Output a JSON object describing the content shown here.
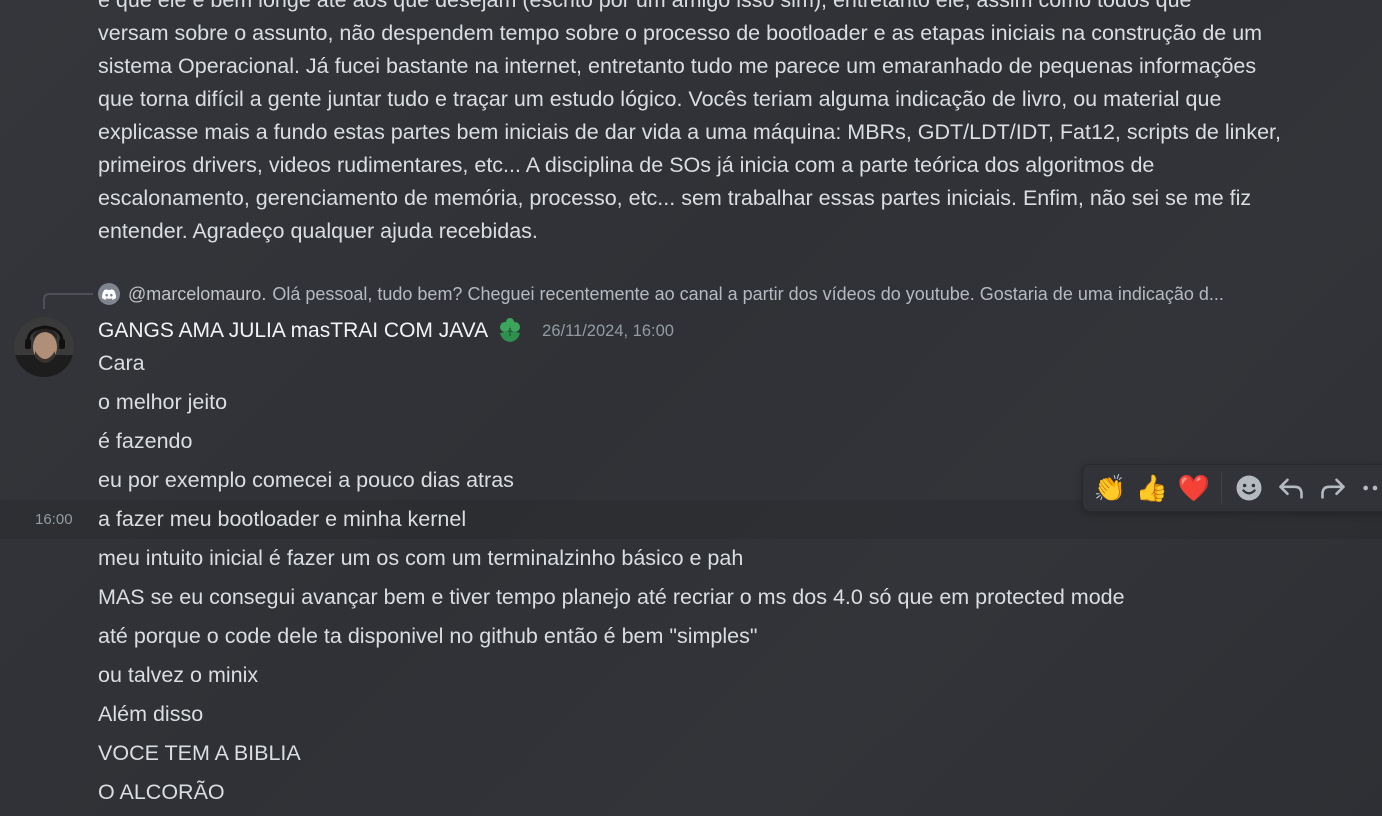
{
  "previous_message": {
    "lines": [
      "e que ele é bem longe ate aos que desejam (escrito por um amigo isso sim), entretanto ele, assim como todos que",
      "versam sobre o assunto, não despendem tempo sobre o processo de bootloader e as etapas iniciais na construção de um",
      "sistema Operacional. Já fucei bastante na internet, entretanto tudo me parece um emaranhado de pequenas informações",
      "que torna difícil a gente juntar tudo e traçar um estudo lógico. Vocês teriam alguma indicação de livro, ou material que",
      "explicasse mais a fundo estas partes bem iniciais de dar vida a uma máquina: MBRs, GDT/LDT/IDT,  Fat12, scripts de linker,",
      "primeiros drivers, videos rudimentares, etc... A disciplina de SOs já inicia com a parte teórica dos algoritmos de",
      "escalonamento, gerenciamento de memória, processo, etc... sem trabalhar essas partes iniciais. Enfim, não sei se me fiz",
      "entender. Agradeço qualquer ajuda recebidas."
    ]
  },
  "reply_reference": {
    "author": "@marcelomauro.",
    "snippet": "Olá pessoal, tudo bem? Cheguei recentemente ao canal a partir dos vídeos do youtube. Gostaria de uma indicação d..."
  },
  "message": {
    "username": "GANGS AMA JULIA masTRAI COM JAVA",
    "timestamp": "26/11/2024, 16:00",
    "hover_time": "16:00",
    "lines": [
      "Cara",
      "o melhor jeito",
      "é fazendo",
      "eu por exemplo comecei a pouco dias atras",
      "a fazer meu bootloader e minha kernel",
      "meu intuito inicial é fazer um os com um terminalzinho básico e pah",
      "MAS se eu consegui avançar bem e tiver tempo planejo até recriar o ms dos 4.0 só que em protected mode",
      "até porque o code dele ta disponivel no github então é bem \"simples\"",
      "ou talvez o minix",
      "Além disso",
      "VOCE TEM A BIBLIA",
      "O ALCORÃO"
    ]
  },
  "toolbar": {
    "reactions": [
      "👏",
      "👍",
      "❤️"
    ],
    "icons": [
      "add-reaction-icon",
      "reply-icon",
      "forward-icon",
      "more-icon"
    ]
  },
  "colors": {
    "background": "#313338",
    "text": "#dbdee1",
    "muted": "#949ba4",
    "role_icon": "#3ba55c"
  }
}
